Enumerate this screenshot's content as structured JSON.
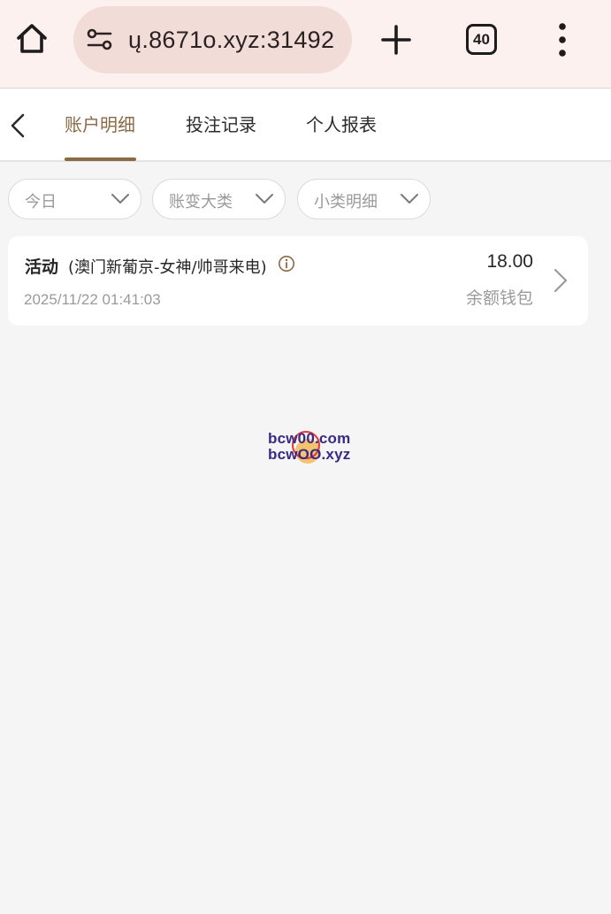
{
  "browser": {
    "url_text": "ų.8671o.xyz:31492",
    "tab_count": "40"
  },
  "tabs": [
    {
      "label": "账户明细",
      "active": true
    },
    {
      "label": "投注记录",
      "active": false
    },
    {
      "label": "个人报表",
      "active": false
    }
  ],
  "filters": {
    "date": "今日",
    "category": "账变大类",
    "subcategory": "小类明细"
  },
  "record": {
    "type": "活动",
    "detail": "(澳门新葡京-女神/帅哥来电)",
    "time": "2025/11/22 01:41:03",
    "amount": "18.00",
    "wallet": "余额钱包"
  },
  "watermark": {
    "line1": "bcw00.com",
    "line2": "bcwOO.xyz"
  },
  "colors": {
    "accent": "#8a6a45",
    "browser_bar": "#fdf1ef",
    "url_box": "#f2dcd7",
    "page_bg": "#f5f5f5"
  }
}
